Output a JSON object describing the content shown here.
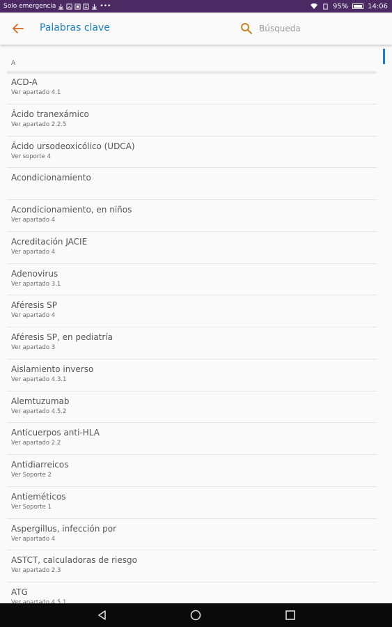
{
  "status_bar": {
    "carrier_text": "Solo emergencia",
    "battery": "95%",
    "time": "14:06"
  },
  "app_bar": {
    "title": "Palabras clave",
    "search_placeholder": "Búsqueda"
  },
  "list": {
    "section_letter": "A",
    "items": [
      {
        "term": "ACD-A",
        "ref": "Ver apartado 4.1"
      },
      {
        "term": "Ácido tranexámico",
        "ref": "Ver apartado 2.2.5"
      },
      {
        "term": "Ácido ursodeoxicólico (UDCA)",
        "ref": "Ver soporte 4"
      },
      {
        "term": "Acondicionamiento",
        "ref": ""
      },
      {
        "term": "Acondicionamiento, en niños",
        "ref": "Ver apartado 4"
      },
      {
        "term": "Acreditación JACIE",
        "ref": "Ver apartado 4"
      },
      {
        "term": "Adenovirus",
        "ref": "Ver apartado 3.1"
      },
      {
        "term": "Aféresis SP",
        "ref": "Ver apartado 4"
      },
      {
        "term": "Aféresis SP, en pediatría",
        "ref": "Ver apartado 3"
      },
      {
        "term": "Aislamiento inverso",
        "ref": "Ver apartado 4.3.1"
      },
      {
        "term": "Alemtuzumab",
        "ref": "Ver apartado 4.5.2"
      },
      {
        "term": "Anticuerpos anti-HLA",
        "ref": "Ver apartado 2.2"
      },
      {
        "term": "Antidiarreicos",
        "ref": "Ver Soporte 2"
      },
      {
        "term": "Antieméticos",
        "ref": "Ver Soporte 1"
      },
      {
        "term": "Aspergillus, infección por",
        "ref": "Ver apartado 4"
      },
      {
        "term": "ASTCT, calculadoras de riesgo",
        "ref": "Ver apartado 2.3"
      },
      {
        "term": "ATG",
        "ref": "Ver apartado 4.5.1"
      }
    ]
  },
  "colors": {
    "status_bar_bg": "#4b2a63",
    "accent": "#1a7fc1"
  }
}
